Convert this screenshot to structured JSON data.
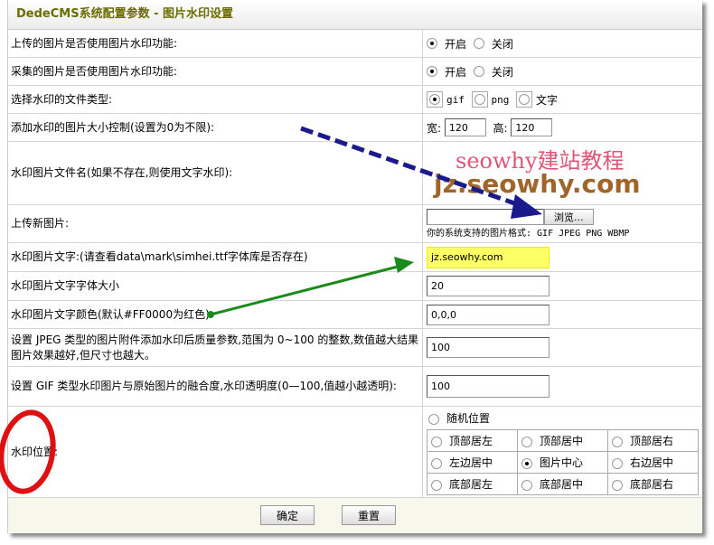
{
  "title": "DedeCMS系统配置参数 - 图片水印设置",
  "rows": {
    "upload_wm": {
      "label": "上传的图片是否使用图片水印功能:",
      "on": "开启",
      "off": "关闭"
    },
    "collect_wm": {
      "label": "采集的图片是否使用图片水印功能:",
      "on": "开启",
      "off": "关闭"
    },
    "type": {
      "label": "选择水印的文件类型:",
      "opts": [
        "gif",
        "png",
        "文字"
      ]
    },
    "size": {
      "label": "添加水印的图片大小控制(设置为0为不限):",
      "w_label": "宽:",
      "w": "120",
      "h_label": "高:",
      "h": "120"
    },
    "file": {
      "label": "水印图片文件名(如果不存在,则使用文字水印):",
      "preview_line1": "seowhy建站教程",
      "preview_line2": "jz.seowhy.com"
    },
    "upload": {
      "label": "上传新图片:",
      "browse": "浏览...",
      "formats": "你的系统支持的图片格式: GIF JPEG PNG WBMP"
    },
    "text": {
      "label": "水印图片文字:(请查看data\\mark\\simhei.ttf字体库是否存在)",
      "value": "jz.seowhy.com"
    },
    "fontsize": {
      "label": "水印图片文字字体大小",
      "value": "20"
    },
    "color": {
      "label": "水印图片文字颜色(默认#FF0000为红色)",
      "value": "0,0,0"
    },
    "jpeg": {
      "label": "设置 JPEG 类型的图片附件添加水印后质量参数,范围为 0~100 的整数,数值越大结果图片效果越好,但尺寸也越大。",
      "value": "100"
    },
    "gif": {
      "label": "设置 GIF 类型水印图片与原始图片的融合度,水印透明度(0—100,值越小越透明):",
      "value": "100"
    },
    "pos": {
      "label": "水印位置:",
      "random": "随机位置",
      "grid": [
        [
          "顶部居左",
          "顶部居中",
          "顶部居右"
        ],
        [
          "左边居中",
          "图片中心",
          "右边居中"
        ],
        [
          "底部居左",
          "底部居中",
          "底部居右"
        ]
      ],
      "selected": "图片中心"
    }
  },
  "footer": {
    "ok": "确定",
    "reset": "重置"
  },
  "colors": {
    "title": "#6b6b00",
    "highlight": "#ffff66",
    "annot_blue": "#1a1a8c",
    "annot_green": "#1a8a1a",
    "annot_red": "#dd1111"
  }
}
